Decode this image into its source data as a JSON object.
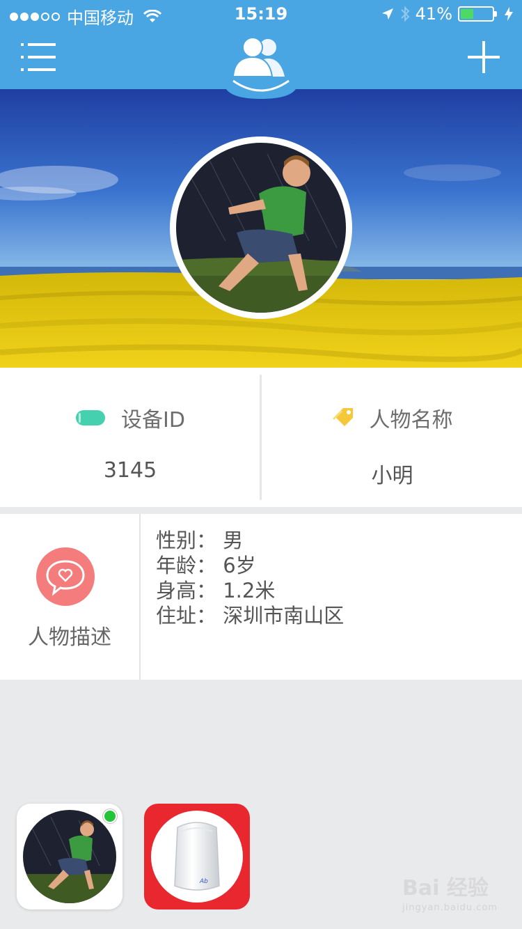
{
  "status_bar": {
    "carrier": "中国移动",
    "time": "15:19",
    "battery": "41%",
    "battery_level": 0.41
  },
  "header": {
    "menu_icon": "list-menu-icon",
    "center_icon": "people-group-icon",
    "add_icon": "plus-icon"
  },
  "device": {
    "label": "设备ID",
    "value": "3145",
    "icon": "device-pill-icon",
    "icon_color": "#45d1b0"
  },
  "person": {
    "label": "人物名称",
    "value": "小明",
    "icon": "tag-icon",
    "icon_color": "#f5c83a"
  },
  "description": {
    "title": "人物描述",
    "icon": "heart-bubble-icon",
    "lines": [
      "性别：  男",
      "年龄：  6岁",
      "身高：  1.2米",
      "住址：  深圳市南山区"
    ]
  },
  "colors": {
    "header": "#4aa6e2",
    "heart": "#f47c7c",
    "device_tile": "#e8282e",
    "online": "#23c43a"
  },
  "watermark": {
    "text": "Bai 经验",
    "sub": "jingyan.baidu.com"
  }
}
